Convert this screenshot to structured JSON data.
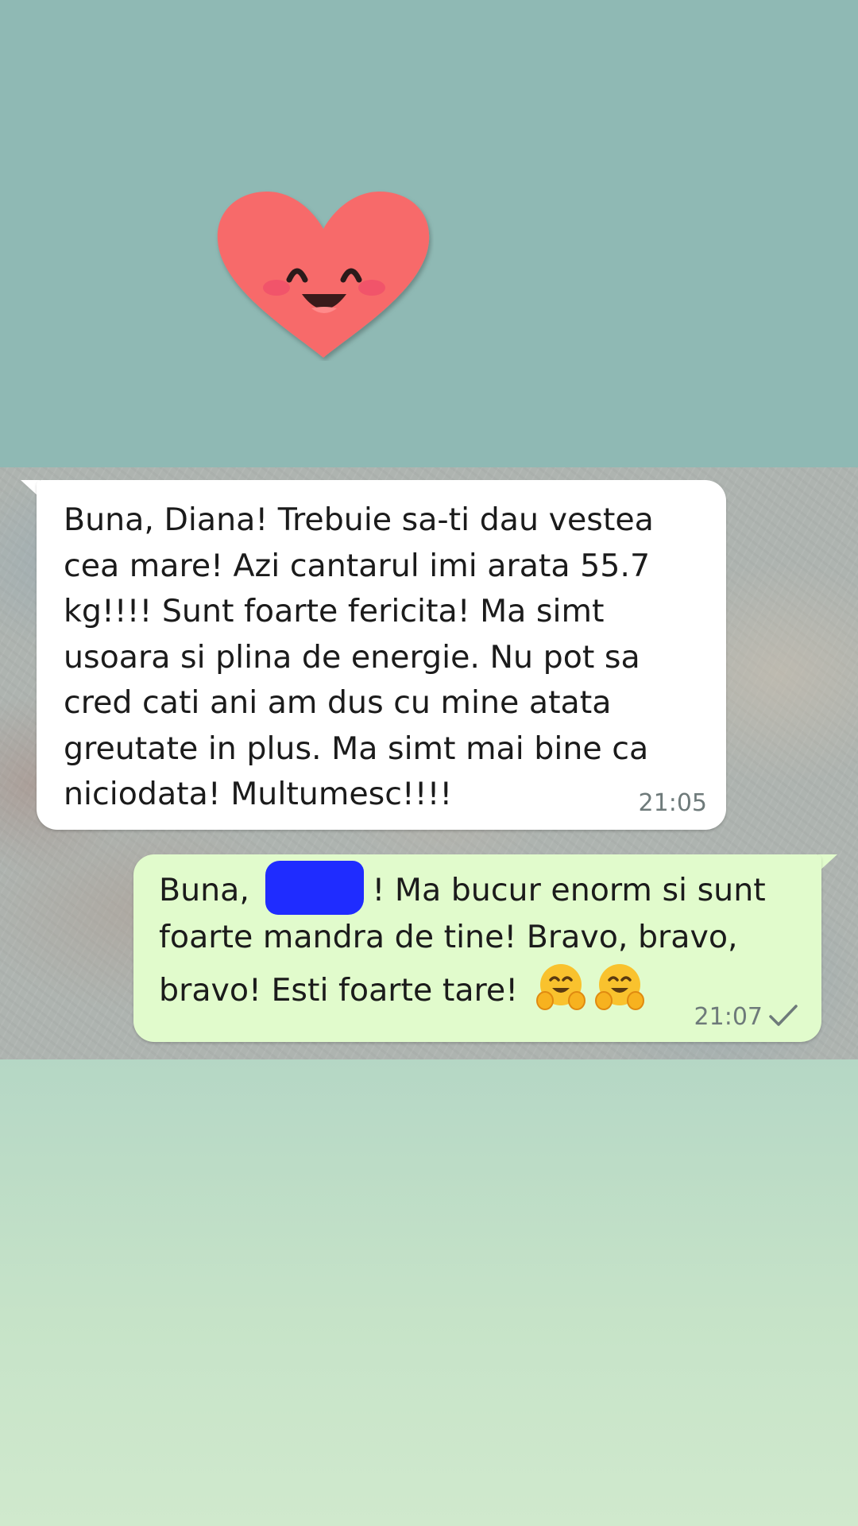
{
  "chat": {
    "incoming": {
      "text": "Buna, Diana! Trebuie sa-ti dau vestea\ncea mare! Azi cantarul imi arata 55.7\nkg!!!! Sunt foarte fericita! Ma simt\nusoara si plina de energie. Nu pot sa\ncred cati ani am dus cu mine atata\ngreutate in plus. Ma simt mai bine ca\nniciodata! Multumesc!!!!",
      "time": "21:05"
    },
    "outgoing": {
      "line1_start": "Buna, ",
      "line1_end": "! Ma bucur enorm si sunt",
      "line2": "foarte mandra de tine! Bravo, bravo,",
      "line3": "bravo! Esti foarte tare! ",
      "emoji": [
        "hugging-face",
        "hugging-face"
      ],
      "time": "21:07",
      "status": "sent-single-check"
    }
  },
  "colors": {
    "top_background": "#8fb9b4",
    "incoming_bubble": "#ffffff",
    "outgoing_bubble": "#e1fbcc",
    "redaction": "#1f2cff",
    "heart": "#f76b6b"
  },
  "decorations": {
    "sticker": "smiling-heart-icon"
  }
}
